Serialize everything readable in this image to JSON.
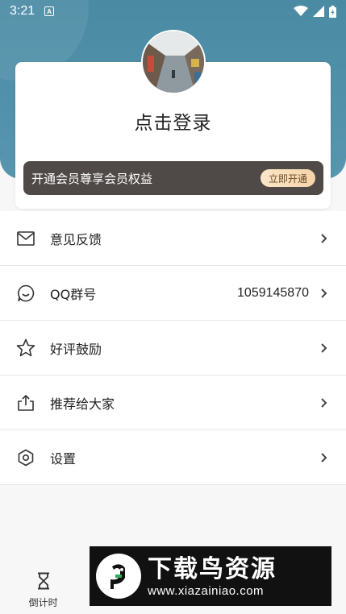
{
  "status_bar": {
    "time": "3:21",
    "badge": "A"
  },
  "profile": {
    "login_text": "点击登录"
  },
  "vip": {
    "text": "开通会员尊享会员权益",
    "button": "立即开通"
  },
  "menu": {
    "items": [
      {
        "icon": "mail-icon",
        "label": "意见反馈",
        "value": ""
      },
      {
        "icon": "chat-smile-icon",
        "label": "QQ群号",
        "value": "1059145870"
      },
      {
        "icon": "star-icon",
        "label": "好评鼓励",
        "value": ""
      },
      {
        "icon": "share-icon",
        "label": "推荐给大家",
        "value": ""
      },
      {
        "icon": "settings-hexagon-icon",
        "label": "设置",
        "value": ""
      }
    ]
  },
  "tabbar": {
    "tabs": [
      {
        "icon": "hourglass-icon",
        "label": "倒计时"
      },
      {
        "icon": "",
        "label": ""
      },
      {
        "icon": "",
        "label": ""
      },
      {
        "icon": "",
        "label": ""
      }
    ]
  },
  "watermark": {
    "title": "下载鸟资源",
    "url": "www.xiazainiao.com"
  },
  "colors": {
    "header": "#4a8aa3",
    "vip_bar": "#4f4a47",
    "vip_button": "#f5d4a6"
  }
}
